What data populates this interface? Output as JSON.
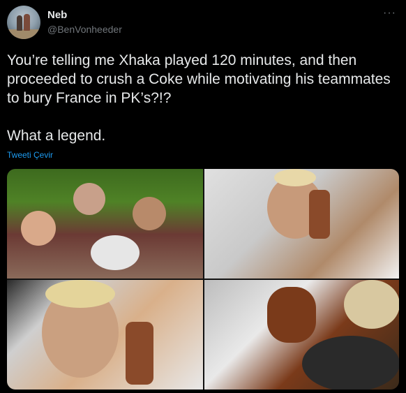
{
  "tweet": {
    "author_name": "Neb",
    "author_handle": "@BenVonheeder",
    "more_icon": "ellipsis-icon",
    "text": "You’re telling me Xhaka played 120 minutes, and then proceeded to crush a Coke while motivating his teammates to bury France in PK’s?!?\n\nWhat a legend.",
    "translate_label": "Tweeti Çevir"
  },
  "media": {
    "count": 4
  }
}
